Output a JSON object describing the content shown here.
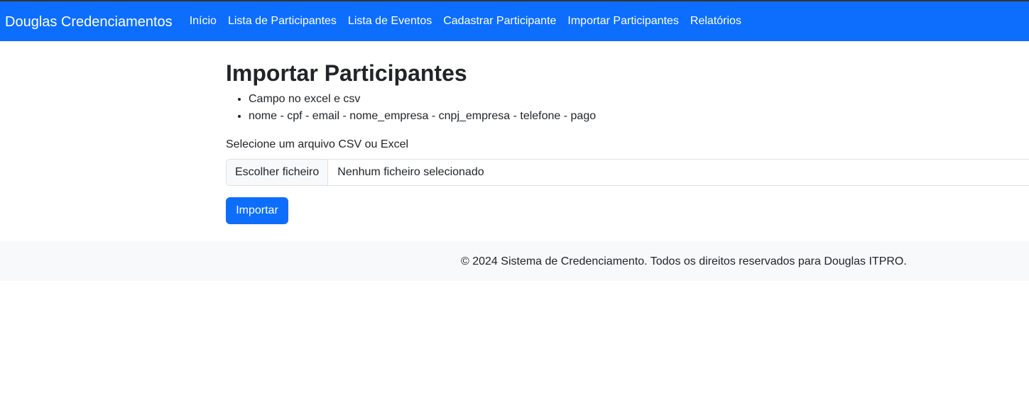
{
  "navbar": {
    "brand": "Douglas Credenciamentos",
    "links": [
      {
        "label": "Início"
      },
      {
        "label": "Lista de Participantes"
      },
      {
        "label": "Lista de Eventos"
      },
      {
        "label": "Cadastrar Participante"
      },
      {
        "label": "Importar Participantes"
      },
      {
        "label": "Relatórios"
      }
    ]
  },
  "main": {
    "title": "Importar Participantes",
    "info_items": [
      "Campo no excel e csv",
      "nome - cpf - email - nome_empresa - cnpj_empresa - telefone - pago"
    ],
    "file_label": "Selecione um arquivo CSV ou Excel",
    "file_button": "Escolher ficheiro",
    "file_status": "Nenhum ficheiro selecionado",
    "submit_label": "Importar"
  },
  "footer": {
    "text": "© 2024 Sistema de Credenciamento. Todos os direitos reservados para Douglas ITPRO."
  },
  "colors": {
    "primary": "#0d6efd",
    "footer_bg": "#f8f9fa",
    "text": "#212529",
    "border": "#dee2e6"
  }
}
